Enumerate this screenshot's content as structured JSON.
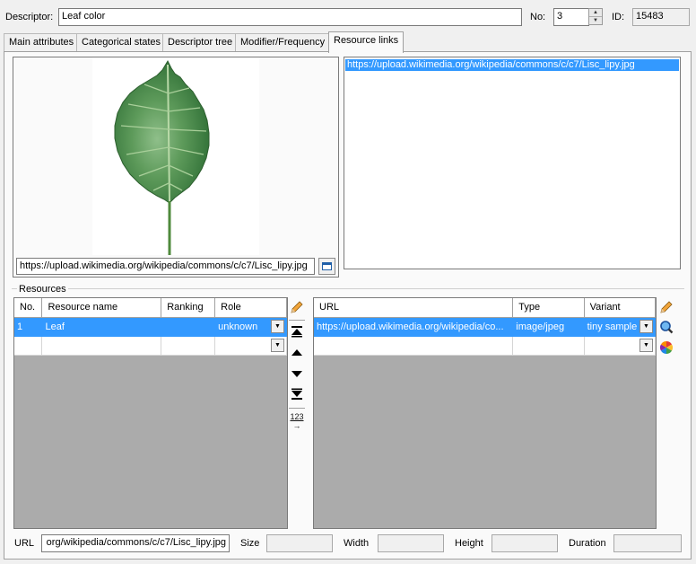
{
  "header": {
    "descriptor_label": "Descriptor:",
    "descriptor_value": "Leaf color",
    "no_label": "No:",
    "no_value": "3",
    "id_label": "ID:",
    "id_value": "15483"
  },
  "tabs": [
    {
      "label": "Main attributes"
    },
    {
      "label": "Categorical states"
    },
    {
      "label": "Descriptor tree"
    },
    {
      "label": "Modifier/Frequency"
    },
    {
      "label": "Resource links"
    }
  ],
  "preview": {
    "url_value": "https://upload.wikimedia.org/wikipedia/commons/c/c7/Lisc_lipy.jpg",
    "image_icon": "leaf-image"
  },
  "url_list": {
    "items": [
      "https://upload.wikimedia.org/wikipedia/commons/c/c7/Lisc_lipy.jpg"
    ]
  },
  "resources": {
    "group_label": "Resources",
    "left_grid": {
      "headers": [
        "No.",
        "Resource name",
        "Ranking",
        "Role"
      ],
      "rows": [
        {
          "no": "1",
          "name": "Leaf",
          "ranking": "",
          "role": "unknown"
        }
      ]
    },
    "right_grid": {
      "headers": [
        "URL",
        "Type",
        "Variant"
      ],
      "rows": [
        {
          "url": "https://upload.wikimedia.org/wikipedia/co...",
          "type": "image/jpeg",
          "variant": "tiny sample"
        }
      ]
    },
    "side_tools": [
      "edit-icon",
      "move-top-icon",
      "move-up-icon",
      "move-down-icon",
      "move-bottom-icon",
      "renumber-icon"
    ],
    "renumber_label": "123",
    "right_tools": [
      "edit-icon",
      "preview-icon",
      "color-icon"
    ]
  },
  "footer": {
    "url_label": "URL",
    "url_value": "org/wikipedia/commons/c/c7/Lisc_lipy.jpg",
    "size_label": "Size",
    "size_value": "",
    "width_label": "Width",
    "width_value": "",
    "height_label": "Height",
    "height_value": "",
    "duration_label": "Duration",
    "duration_value": ""
  },
  "colors": {
    "selection": "#3399ff",
    "grid_background": "#ababab"
  }
}
